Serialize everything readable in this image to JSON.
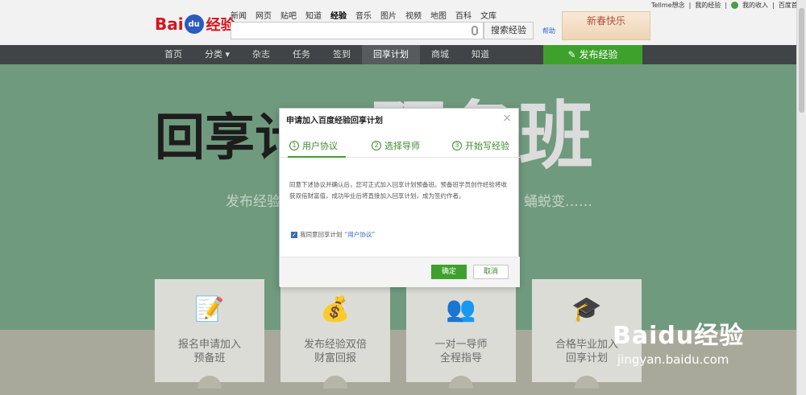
{
  "header": {
    "logo": {
      "bai": "Bai",
      "du": "du",
      "jingyan": "经验"
    },
    "topnav": [
      "新闻",
      "网页",
      "贴吧",
      "知道",
      "经验",
      "音乐",
      "图片",
      "视频",
      "地图",
      "百科",
      "文库"
    ],
    "active_topnav_index": 4,
    "search_placeholder": "",
    "search_button": "搜索经验",
    "help": "帮助",
    "banner": "新春快乐",
    "user": {
      "name": "Tellme想念",
      "my_jingyan": "我的经验",
      "my_income": "我的收入",
      "baidu_home": "百度首页"
    }
  },
  "mainnav": {
    "items": [
      "首页",
      "分类",
      "杂志",
      "任务",
      "签到",
      "回享计划",
      "商城",
      "知道"
    ],
    "active_index": 5,
    "publish": "发布经验"
  },
  "hero": {
    "calli_left": "回享计",
    "calli_right": "预备班",
    "slogan_left": "发布经验",
    "slogan_right": "蛹蜕变……"
  },
  "cards": [
    {
      "icon": "certificate-icon",
      "line1": "报名申请加入",
      "line2": "预备班"
    },
    {
      "icon": "money-bag-icon",
      "line1": "发布经验双倍",
      "line2": "财富回报"
    },
    {
      "icon": "people-icon",
      "line1": "一对一导师",
      "line2": "全程指导"
    },
    {
      "icon": "graduation-icon",
      "line1": "合格毕业加入",
      "line2": "回享计划"
    }
  ],
  "modal": {
    "title": "申请加入百度经验回享计划",
    "steps": [
      {
        "num": "1",
        "label": "用户协议"
      },
      {
        "num": "2",
        "label": "选择导师"
      },
      {
        "num": "3",
        "label": "开始写经验"
      }
    ],
    "agreement_text": "同意下述协议并确认后，您可正式加入回享计划预备班。预备班学员创作经验将收获双倍财富值，成功毕业后将直接加入回享计划，成为签约作者。",
    "agree_label": "我同意回享计划",
    "agree_link": "“用户协议”",
    "ok": "确定",
    "cancel": "取消"
  },
  "watermark": {
    "brand": "Baidu经验",
    "url": "jingyan.baidu.com"
  },
  "colors": {
    "accent_green": "#3ea12c",
    "nav_dark": "#404446",
    "hero_green": "#6f9a7e"
  }
}
